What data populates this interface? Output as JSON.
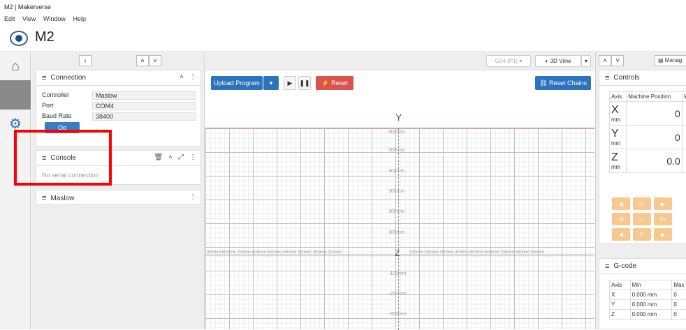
{
  "window": {
    "title": "M2 | Makerverse"
  },
  "menu": [
    "Edit",
    "View",
    "Window",
    "Help"
  ],
  "app": {
    "title": "M2"
  },
  "connection": {
    "title": "Connection",
    "rows": [
      {
        "label": "Controller",
        "value": "Maslow"
      },
      {
        "label": "Port",
        "value": "COM4"
      },
      {
        "label": "Baud Rate",
        "value": "38400"
      }
    ],
    "button": "Op"
  },
  "console": {
    "title": "Console",
    "status": "No serial connection"
  },
  "maslow": {
    "title": "Maslow"
  },
  "toolbar": {
    "upload": "Upload Program",
    "reset": "Reset",
    "reset_chains": "Reset Chains",
    "coord": "G54 (P1)",
    "view": "3D View"
  },
  "visualizer": {
    "axis_y": "Y",
    "axis_z": "Z",
    "y_labels": [
      "600mm",
      "500mm",
      "400mm",
      "300mm",
      "200mm",
      "100mm",
      "-100mm",
      "-200mm",
      "-300mm"
    ],
    "x_neg": "800mm 800mm 700mm 600mm 500mm 400mm 300mm 200mm 100mm",
    "x_pos": "100mm 200mm 300mm 400mm 500mm 600mm 700mm 800mm 900mm"
  },
  "controls": {
    "title": "Controls",
    "header": [
      "Axis",
      "Machine Position",
      "W"
    ],
    "rows": [
      {
        "axis": "X",
        "unit": "mm",
        "value": "0"
      },
      {
        "axis": "Y",
        "unit": "mm",
        "value": "0"
      },
      {
        "axis": "Z",
        "unit": "mm",
        "value": "0.0"
      }
    ],
    "jog": [
      [
        "",
        "Y+",
        ""
      ],
      [
        "-X",
        "",
        "X+"
      ],
      [
        "",
        "Y-",
        ""
      ]
    ],
    "manage": "Manag"
  },
  "gcode": {
    "title": "G-code",
    "header": [
      "Axis",
      "Min",
      "Max"
    ],
    "rows": [
      {
        "axis": "X",
        "min": "0.000 mm",
        "max": "0"
      },
      {
        "axis": "Y",
        "min": "0.000 mm",
        "max": "0"
      },
      {
        "axis": "Z",
        "min": "0.000 mm",
        "max": "0"
      }
    ]
  }
}
